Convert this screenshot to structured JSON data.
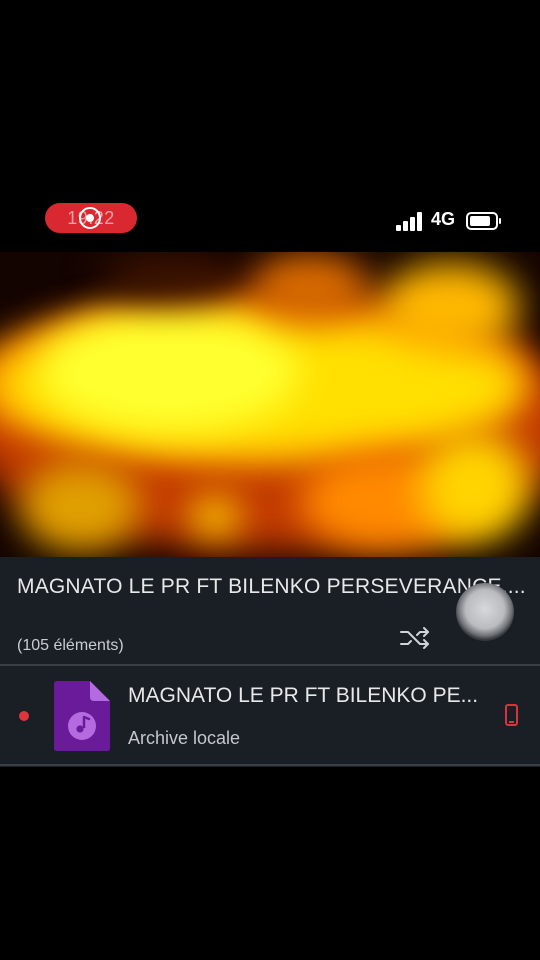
{
  "status_bar": {
    "recording_time": "19:22",
    "network": "4G"
  },
  "player": {
    "playlist_title": "MAGNATO LE PR FT BILENKO PERSEVERANCE....",
    "item_count": "(105 éléments)"
  },
  "track": {
    "title": "MAGNATO LE PR FT BILENKO PE...",
    "subtitle": "Archive locale",
    "icon": "music-file-icon"
  },
  "colors": {
    "accent": "#d9282f",
    "panel": "#1a1f26",
    "file_icon": "#6a1b9a"
  }
}
